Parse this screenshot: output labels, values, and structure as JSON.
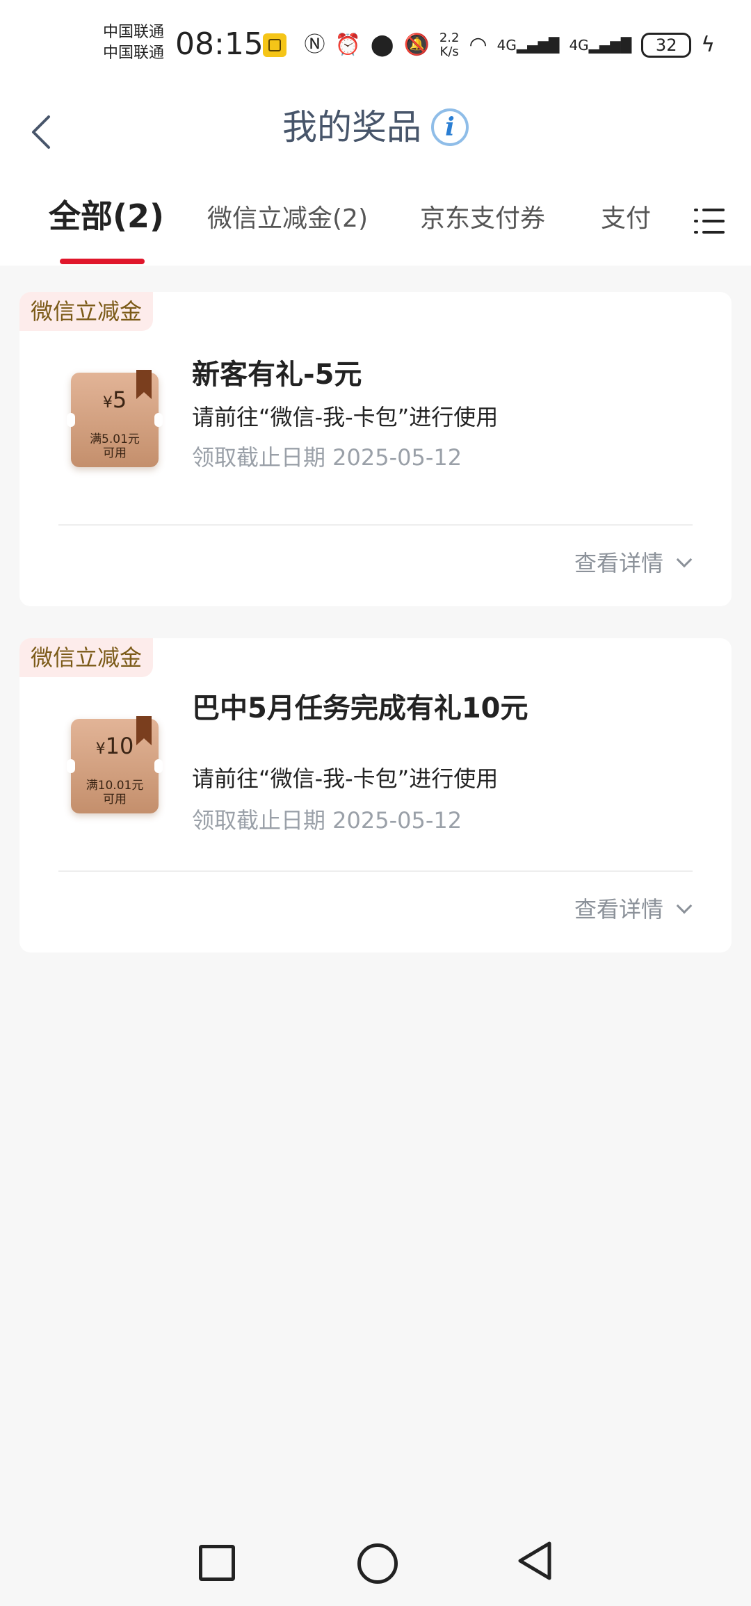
{
  "status_bar": {
    "carrier_1": "中国联通",
    "carrier_2": "中国联通",
    "time": "08:15",
    "net_speed_value": "2.2",
    "net_speed_unit": "K/s",
    "network_1": "4G",
    "network_2": "4G",
    "battery": "32"
  },
  "header": {
    "title": "我的奖品",
    "info_icon": "i"
  },
  "tabs": [
    {
      "label": "全部(2)",
      "active": true
    },
    {
      "label": "微信立减金(2)",
      "active": false
    },
    {
      "label": "京东支付券",
      "active": false
    },
    {
      "label": "支付",
      "active": false
    }
  ],
  "prizes": [
    {
      "tag": "微信立减金",
      "coupon_currency": "¥",
      "coupon_amount": "5",
      "coupon_condition": "满5.01元",
      "coupon_usable": "可用",
      "title": "新客有礼-5元",
      "description": "请前往“微信-我-卡包”进行使用",
      "deadline": "领取截止日期 2025-05-12",
      "detail_label": "查看详情"
    },
    {
      "tag": "微信立减金",
      "coupon_currency": "¥",
      "coupon_amount": "10",
      "coupon_condition": "满10.01元",
      "coupon_usable": "可用",
      "title": "巴中5月任务完成有礼10元",
      "description": "请前往“微信-我-卡包”进行使用",
      "deadline": "领取截止日期 2025-05-12",
      "detail_label": "查看详情"
    }
  ],
  "colors": {
    "tab_underline": "#e0162b",
    "tag_bg": "#fdeceb",
    "tag_text": "#7b5a17",
    "title_text": "#47556a"
  }
}
